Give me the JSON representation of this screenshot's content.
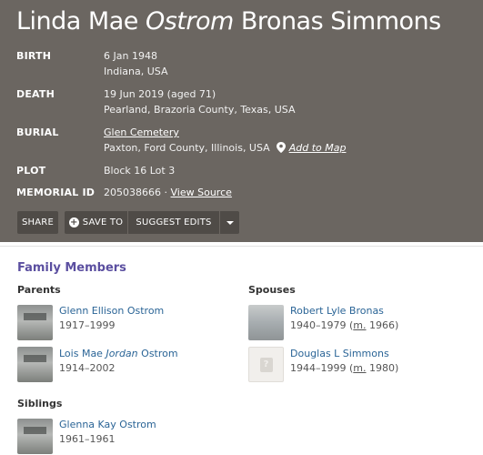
{
  "memorial": {
    "name_first": "Linda Mae",
    "name_maiden": "Ostrom",
    "name_last": "Bronas Simmons"
  },
  "facts": {
    "birth_label": "BIRTH",
    "birth_date": "6 Jan 1948",
    "birth_place": "Indiana, USA",
    "death_label": "DEATH",
    "death_date": "19 Jun 2019 (aged 71)",
    "death_place": "Pearland, Brazoria County, Texas, USA",
    "burial_label": "BURIAL",
    "burial_cemetery": "Glen Cemetery",
    "burial_place": "Paxton, Ford County, Illinois, USA",
    "add_to_map": "Add to Map",
    "plot_label": "PLOT",
    "plot_value": "Block 16 Lot 3",
    "memorial_id_label": "MEMORIAL ID",
    "memorial_id": "205038666",
    "id_separator": " · ",
    "view_source": "View Source"
  },
  "actions": {
    "share": "SHARE",
    "save_to": "SAVE TO",
    "suggest_edits": "SUGGEST EDITS"
  },
  "family": {
    "title": "Family Members",
    "parents_label": "Parents",
    "spouses_label": "Spouses",
    "siblings_label": "Siblings",
    "parents": [
      {
        "name": "Glenn Ellison Ostrom",
        "dates": "1917–1999"
      },
      {
        "name_first": "Lois Mae",
        "name_maiden": "Jordan",
        "name_last": "Ostrom",
        "dates": "1914–2002"
      }
    ],
    "spouses": [
      {
        "name": "Robert Lyle Bronas",
        "dates_pre": "1940–1979 (",
        "married_abbr": "m.",
        "dates_post": " 1966)"
      },
      {
        "name": "Douglas L Simmons",
        "dates_pre": "1944–1999 (",
        "married_abbr": "m.",
        "dates_post": " 1980)"
      }
    ],
    "siblings": [
      {
        "name": "Glenna Kay Ostrom",
        "dates": "1961–1961"
      }
    ]
  },
  "colors": {
    "hero_bg": "#6b6661",
    "button_bg": "#4f4b47",
    "section_title": "#5b4fa0",
    "link": "#2a6496"
  }
}
